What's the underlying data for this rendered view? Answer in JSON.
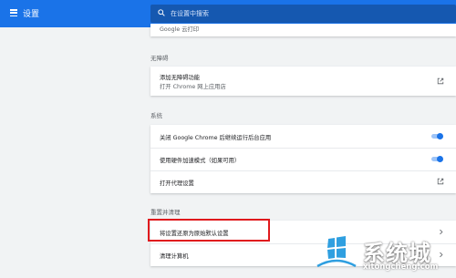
{
  "header": {
    "title": "设置",
    "search_placeholder": "在设置中搜索",
    "menu_icon": "hamburger-menu-icon",
    "search_icon": "search-icon"
  },
  "sections": {
    "top_partial": {
      "label": "Google 云打印"
    },
    "accessibility": {
      "title": "无障碍",
      "item_title": "添加无障碍功能",
      "item_sub": "打开 Chrome 网上应用店"
    },
    "system": {
      "title": "系统",
      "items": [
        {
          "label": "关闭 Google Chrome 后继续运行后台应用",
          "control": "toggle",
          "on": true
        },
        {
          "label": "使用硬件加速模式（如果可用）",
          "control": "toggle",
          "on": true
        },
        {
          "label": "打开代理设置",
          "control": "external-link"
        }
      ]
    },
    "reset": {
      "title": "重置并清理",
      "items": [
        {
          "label": "将设置还原为原始默认设置",
          "control": "chevron"
        },
        {
          "label": "清理计算机",
          "control": "chevron"
        }
      ]
    }
  },
  "watermark": {
    "brand": "系统城",
    "url": "xitongcheng.com"
  },
  "colors": {
    "topbar": "#1a73e8",
    "toggle_on": "#1a73e8",
    "highlight_border": "#e0191d",
    "background": "#f1f3f4"
  }
}
